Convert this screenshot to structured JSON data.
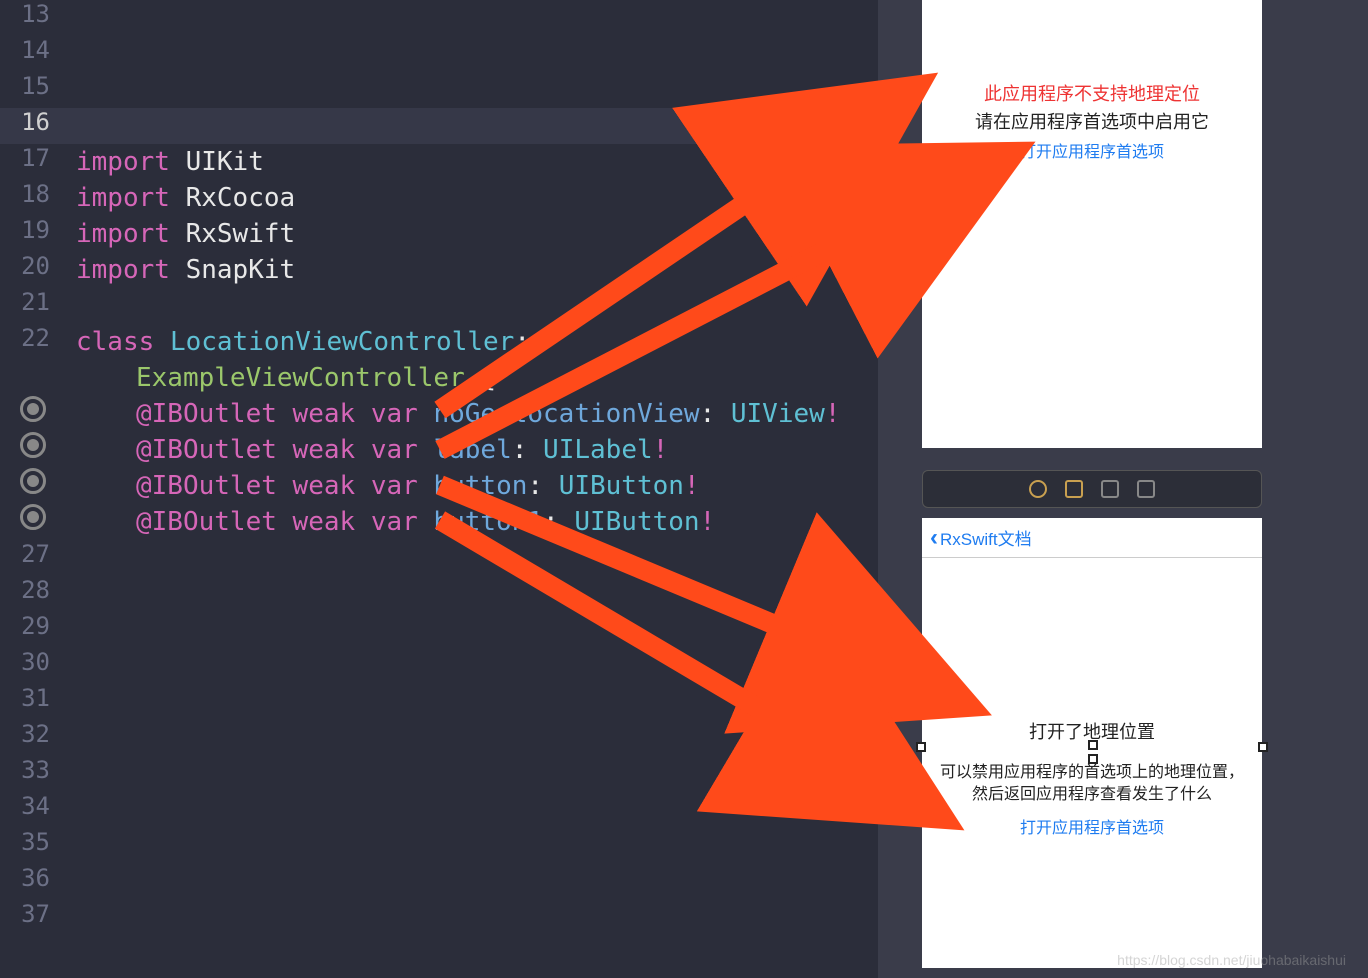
{
  "editor": {
    "line_numbers": [
      "13",
      "14",
      "15",
      "16",
      "17",
      "18",
      "19",
      "20",
      "21",
      "22",
      "",
      "",
      "",
      "",
      "",
      "27",
      "28",
      "29",
      "30",
      "31",
      "32",
      "33",
      "34",
      "35",
      "36",
      "37"
    ],
    "highlighted_line_index": 3,
    "imports": {
      "kw": "import",
      "modules": [
        "UIKit",
        "RxCocoa",
        "RxSwift",
        "SnapKit"
      ]
    },
    "class_decl": {
      "kw_class": "class",
      "name": "LocationViewController",
      "colon": ":",
      "super": "ExampleViewController",
      "brace": " {"
    },
    "outlets": [
      {
        "attr": "@IBOutlet",
        "weak": "weak",
        "var": "var",
        "name": "noGeolocationView",
        "colon": ":",
        "type": "UIView",
        "bang": "!"
      },
      {
        "attr": "@IBOutlet",
        "weak": "weak",
        "var": "var",
        "name": "label",
        "colon": ":",
        "type": "UILabel",
        "bang": "!"
      },
      {
        "attr": "@IBOutlet",
        "weak": "weak",
        "var": "var",
        "name": "button",
        "colon": ":",
        "type": "UIButton",
        "bang": "!"
      },
      {
        "attr": "@IBOutlet",
        "weak": "weak",
        "var": "var",
        "name": "button1",
        "colon": ":",
        "type": "UIButton",
        "bang": "!"
      }
    ]
  },
  "sim1": {
    "title": "此应用程序不支持地理定位",
    "subtitle": "请在应用程序首选项中启用它",
    "link": "打开应用程序首选项"
  },
  "sim2": {
    "back": "RxSwift文档",
    "label1": "打开了地理位置",
    "label2_line1": "可以禁用应用程序的首选项上的地理位置，",
    "label2_line2": "然后返回应用程序查看发生了什么",
    "link": "打开应用程序首选项"
  },
  "watermark": "https://blog.csdn.net/jiuohabaikaishui"
}
